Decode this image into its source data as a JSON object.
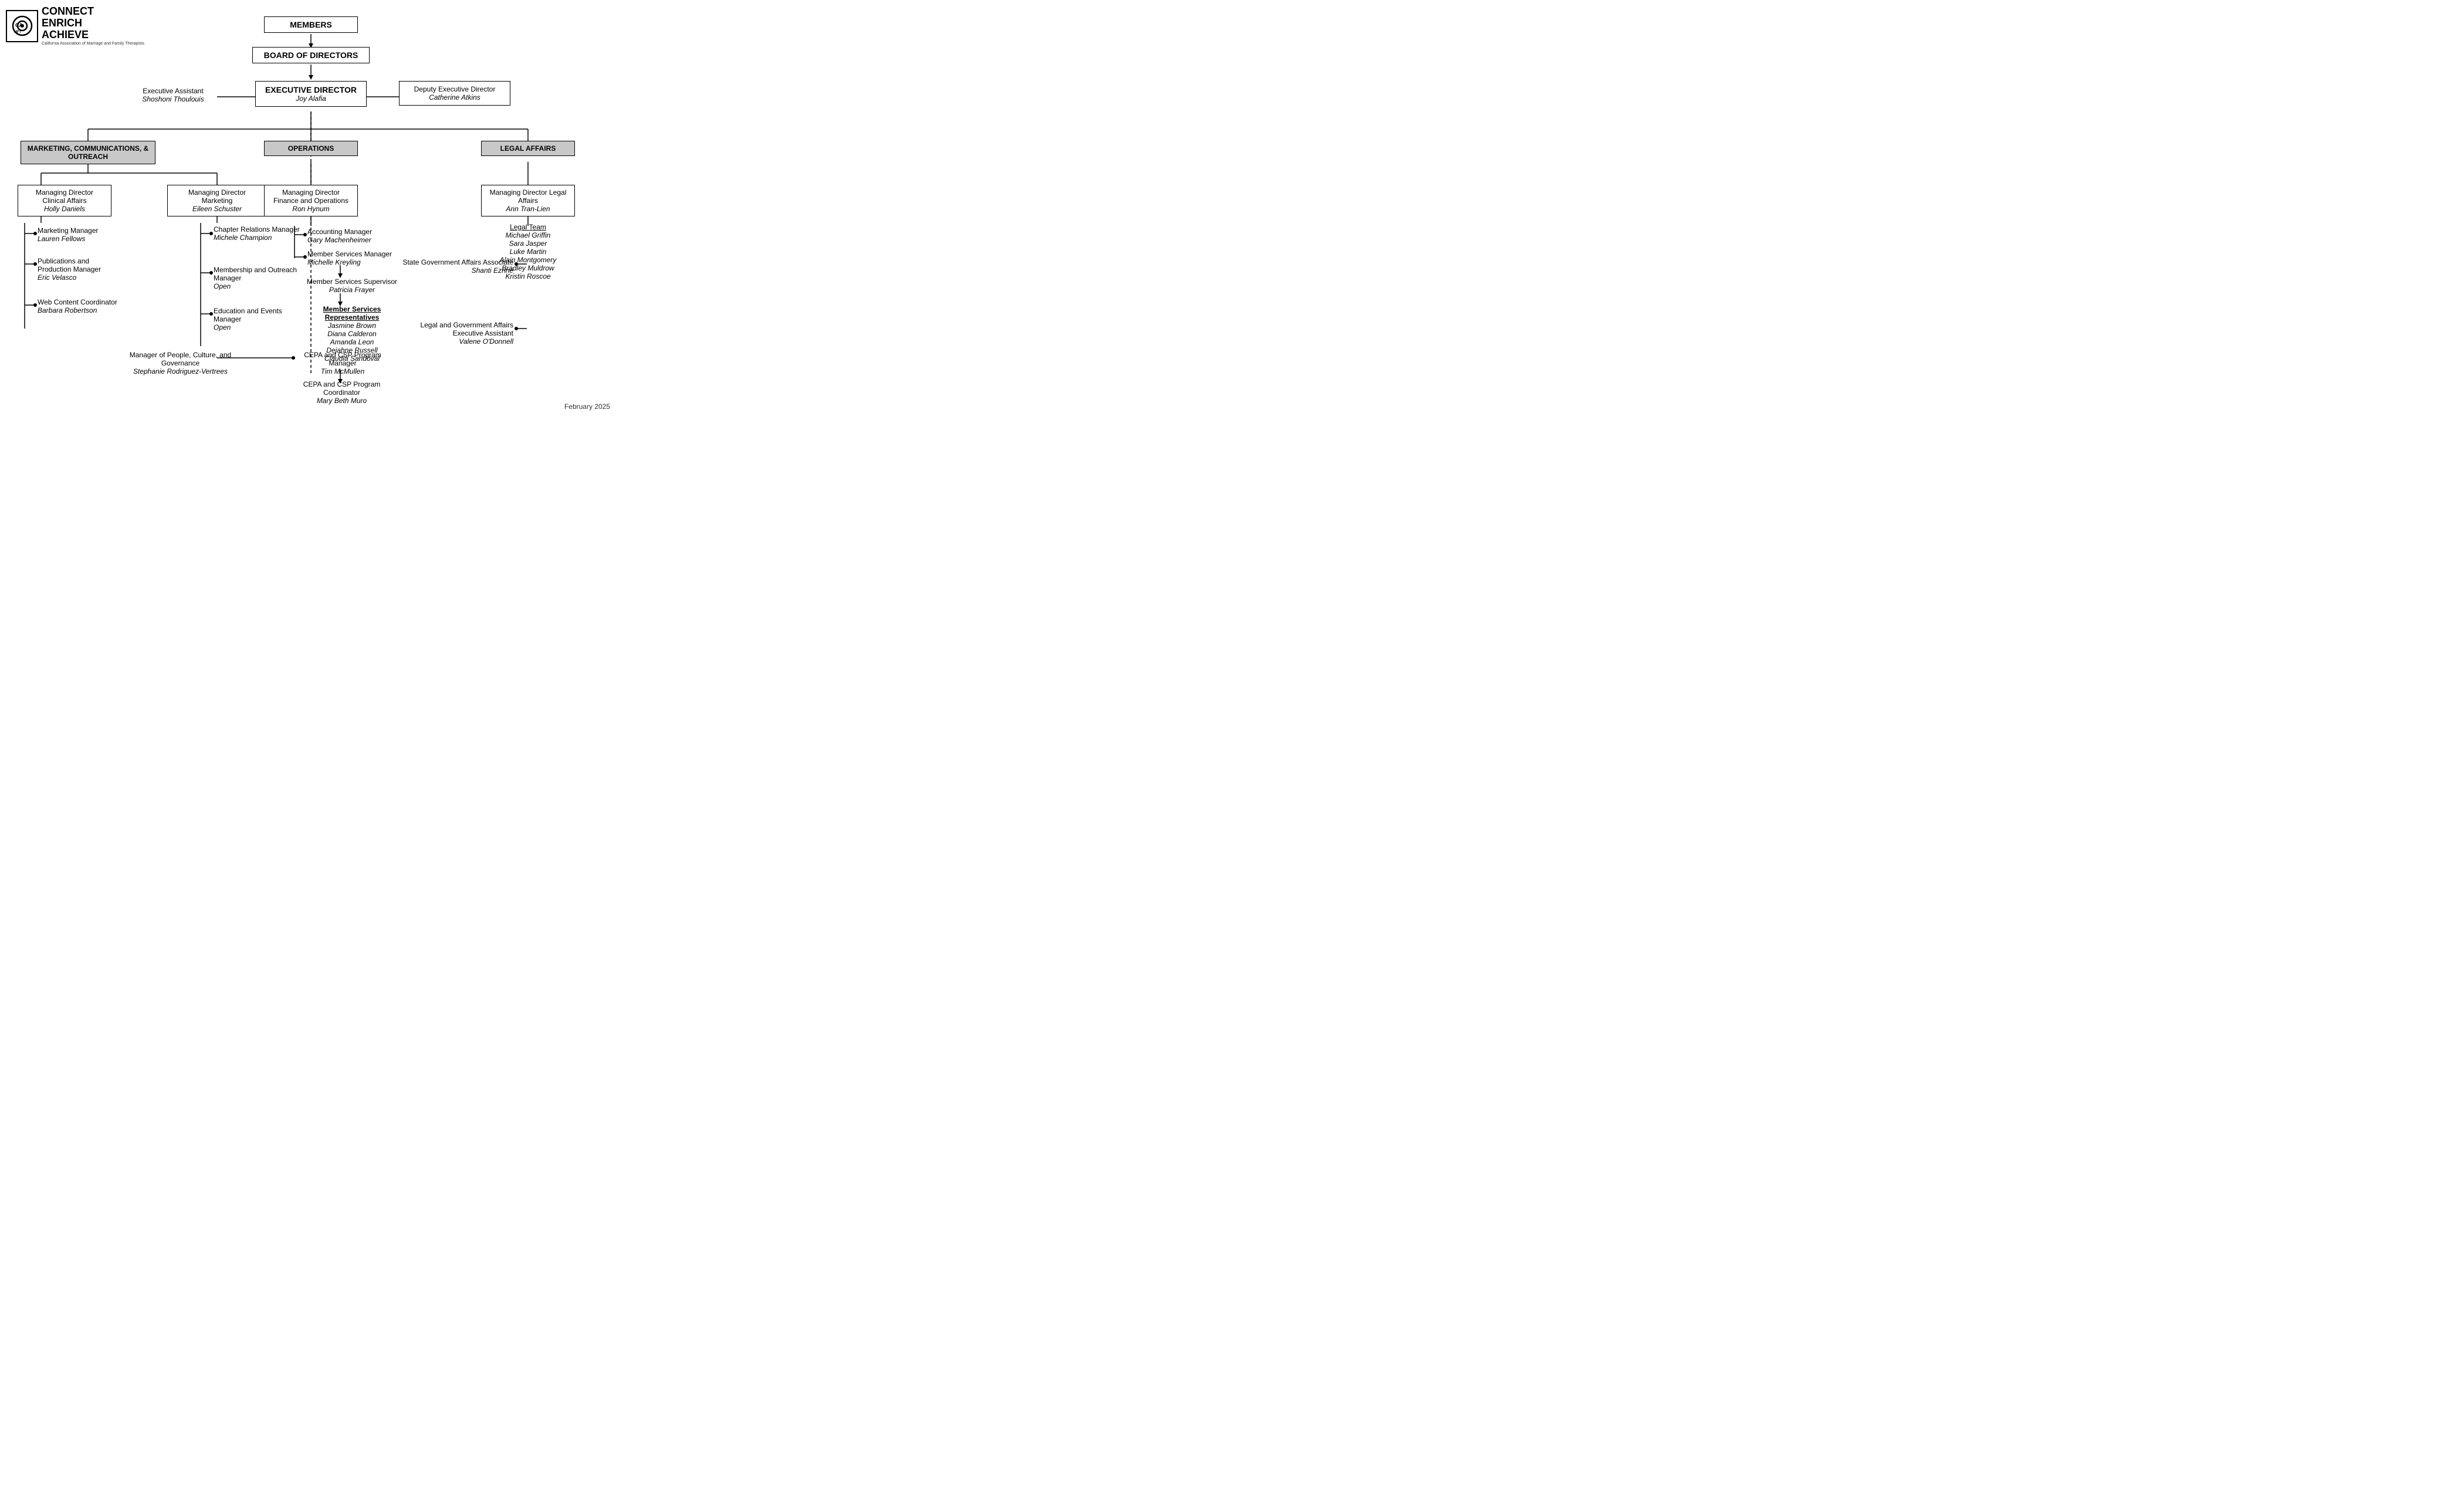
{
  "logo": {
    "symbol": "◎",
    "name": "CONNECT\nENRICH\nACHIEVE",
    "subtitle": "California Association of Marriage and Family Therapists"
  },
  "date": "February 2025",
  "nodes": {
    "members": {
      "label": "MEMBERS"
    },
    "board": {
      "label": "BOARD OF DIRECTORS"
    },
    "exec_dir": {
      "title": "EXECUTIVE DIRECTOR",
      "name": "Joy Alafia"
    },
    "exec_asst": {
      "title": "Executive Assistant",
      "name": "Shoshoni Thoulouis"
    },
    "deputy": {
      "title": "Deputy Executive Director",
      "name": "Catherine Atkins"
    },
    "mco_dept": {
      "label": "MARKETING, COMMUNICATIONS, & OUTREACH"
    },
    "ops_dept": {
      "label": "OPERATIONS"
    },
    "legal_dept": {
      "label": "LEGAL AFFAIRS"
    },
    "md_clinical": {
      "title": "Managing Director Clinical Affairs",
      "name": "Holly Daniels"
    },
    "md_marketing": {
      "title": "Managing Director Marketing",
      "name": "Eileen Schuster"
    },
    "md_finance": {
      "title": "Managing Director Finance and Operations",
      "name": "Ron Hynum"
    },
    "md_legal": {
      "title": "Managing Director Legal Affairs",
      "name": "Ann Tran-Lien"
    },
    "marketing_mgr": {
      "title": "Marketing Manager",
      "name": "Lauren Fellows"
    },
    "chapter_mgr": {
      "title": "Chapter Relations Manager",
      "name": "Michele Champion"
    },
    "accounting_mgr": {
      "title": "Accounting Manager",
      "name": "Gary Machenheimer"
    },
    "legal_team": {
      "header": "Legal Team",
      "members": [
        "Michael Griffin",
        "Sara Jasper",
        "Luke Martin",
        "Alain Montgomery",
        "Bradley Muldrow",
        "Kristin Roscoe"
      ]
    },
    "pub_mgr": {
      "title": "Publications and Production Manager",
      "name": "Eric Velasco"
    },
    "membership_mgr": {
      "title": "Membership and Outreach Manager",
      "name": "Open"
    },
    "member_svc_mgr": {
      "title": "Member Services Manager",
      "name": "Michelle Kreyling"
    },
    "state_govt": {
      "title": "State Government Affairs Associate",
      "name": "Shanti Ezrine"
    },
    "web_coord": {
      "title": "Web Content Coordinator",
      "name": "Barbara Robertson"
    },
    "edu_mgr": {
      "title": "Education and Events Manager",
      "name": "Open"
    },
    "member_svc_sup": {
      "title": "Member Services Supervisor",
      "name": "Patricia Frayer"
    },
    "legal_govt_asst": {
      "title": "Legal and Government Affairs Executive Assistant",
      "name": "Valene O'Donnell"
    },
    "people_mgr": {
      "title": "Manager of People, Culture, and Governance",
      "name": "Stephanie Rodriguez-Vertrees"
    },
    "cepa_mgr": {
      "title": "CEPA and CSP Program Manager",
      "name": "Tim McMullen"
    },
    "member_reps": {
      "header": "Member Services Representatives",
      "members": [
        "Jasmine Brown",
        "Diana Calderon",
        "Amanda Leon",
        "Dejahne Russell",
        "Claudia Sandoval"
      ]
    },
    "cepa_coord": {
      "title": "CEPA and CSP Program Coordinator",
      "name": "Mary Beth Muro"
    }
  }
}
